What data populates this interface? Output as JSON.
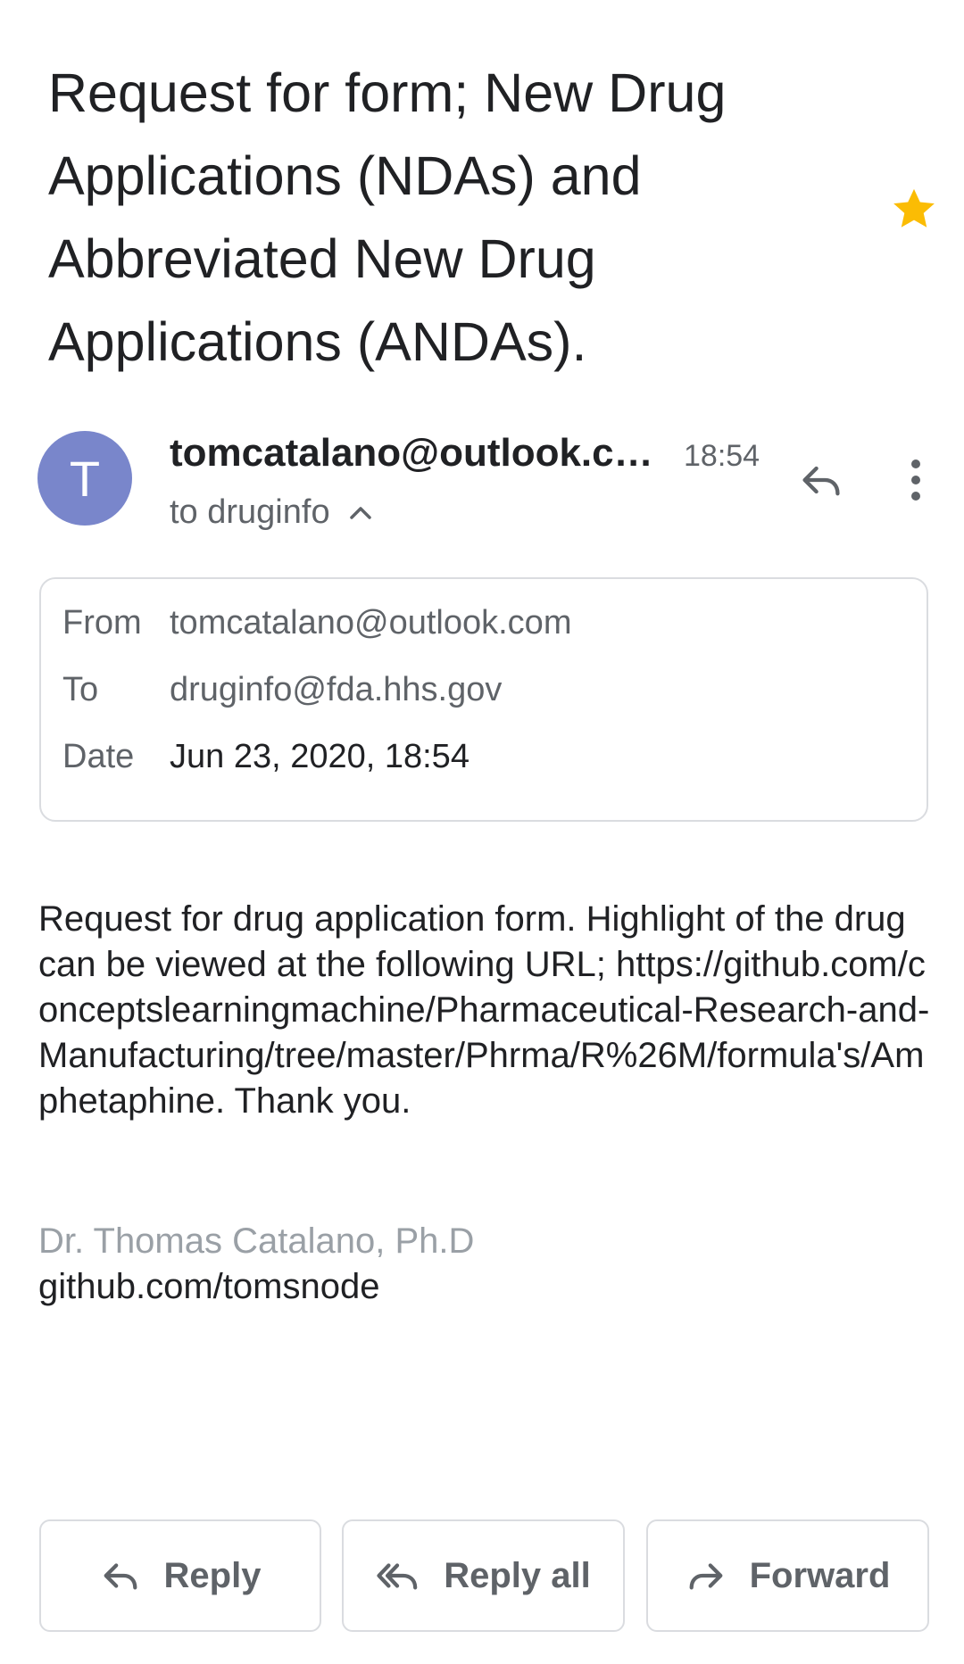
{
  "email": {
    "subject": "Request for form; New Drug Applications (NDAs) and Abbreviated New Drug Applications (ANDAs).",
    "starred": true,
    "star_color": "#fbbc04",
    "avatar_letter": "T",
    "avatar_color": "#7986cb",
    "sender": "tomcatalano@outlook.com",
    "time": "18:54",
    "to_summary": "to druginfo",
    "details": {
      "from_label": "From",
      "from_value": "tomcatalano@outlook.com",
      "to_label": "To",
      "to_value": "druginfo@fda.hhs.gov",
      "date_label": "Date",
      "date_value": "Jun 23, 2020, 18:54"
    },
    "body": "Request for drug application form. Highlight of the drug can be viewed at the following URL; https://github.com/conceptslearningmachine/Pharmaceutical-Research-and-Manufacturing/tree/master/Phrma/R%26M/formula's/Amphetaphine. Thank you.",
    "signature_name": "Dr. Thomas Catalano, Ph.D",
    "signature_link": "github.com/tomsnode"
  },
  "actions": {
    "reply": "Reply",
    "reply_all": "Reply all",
    "forward": "Forward"
  },
  "icons": {
    "star": "star-icon",
    "reply": "reply-icon",
    "more": "more-vert-icon",
    "chevron": "chevron-up-icon",
    "reply_all": "reply-all-icon",
    "forward": "forward-icon"
  }
}
